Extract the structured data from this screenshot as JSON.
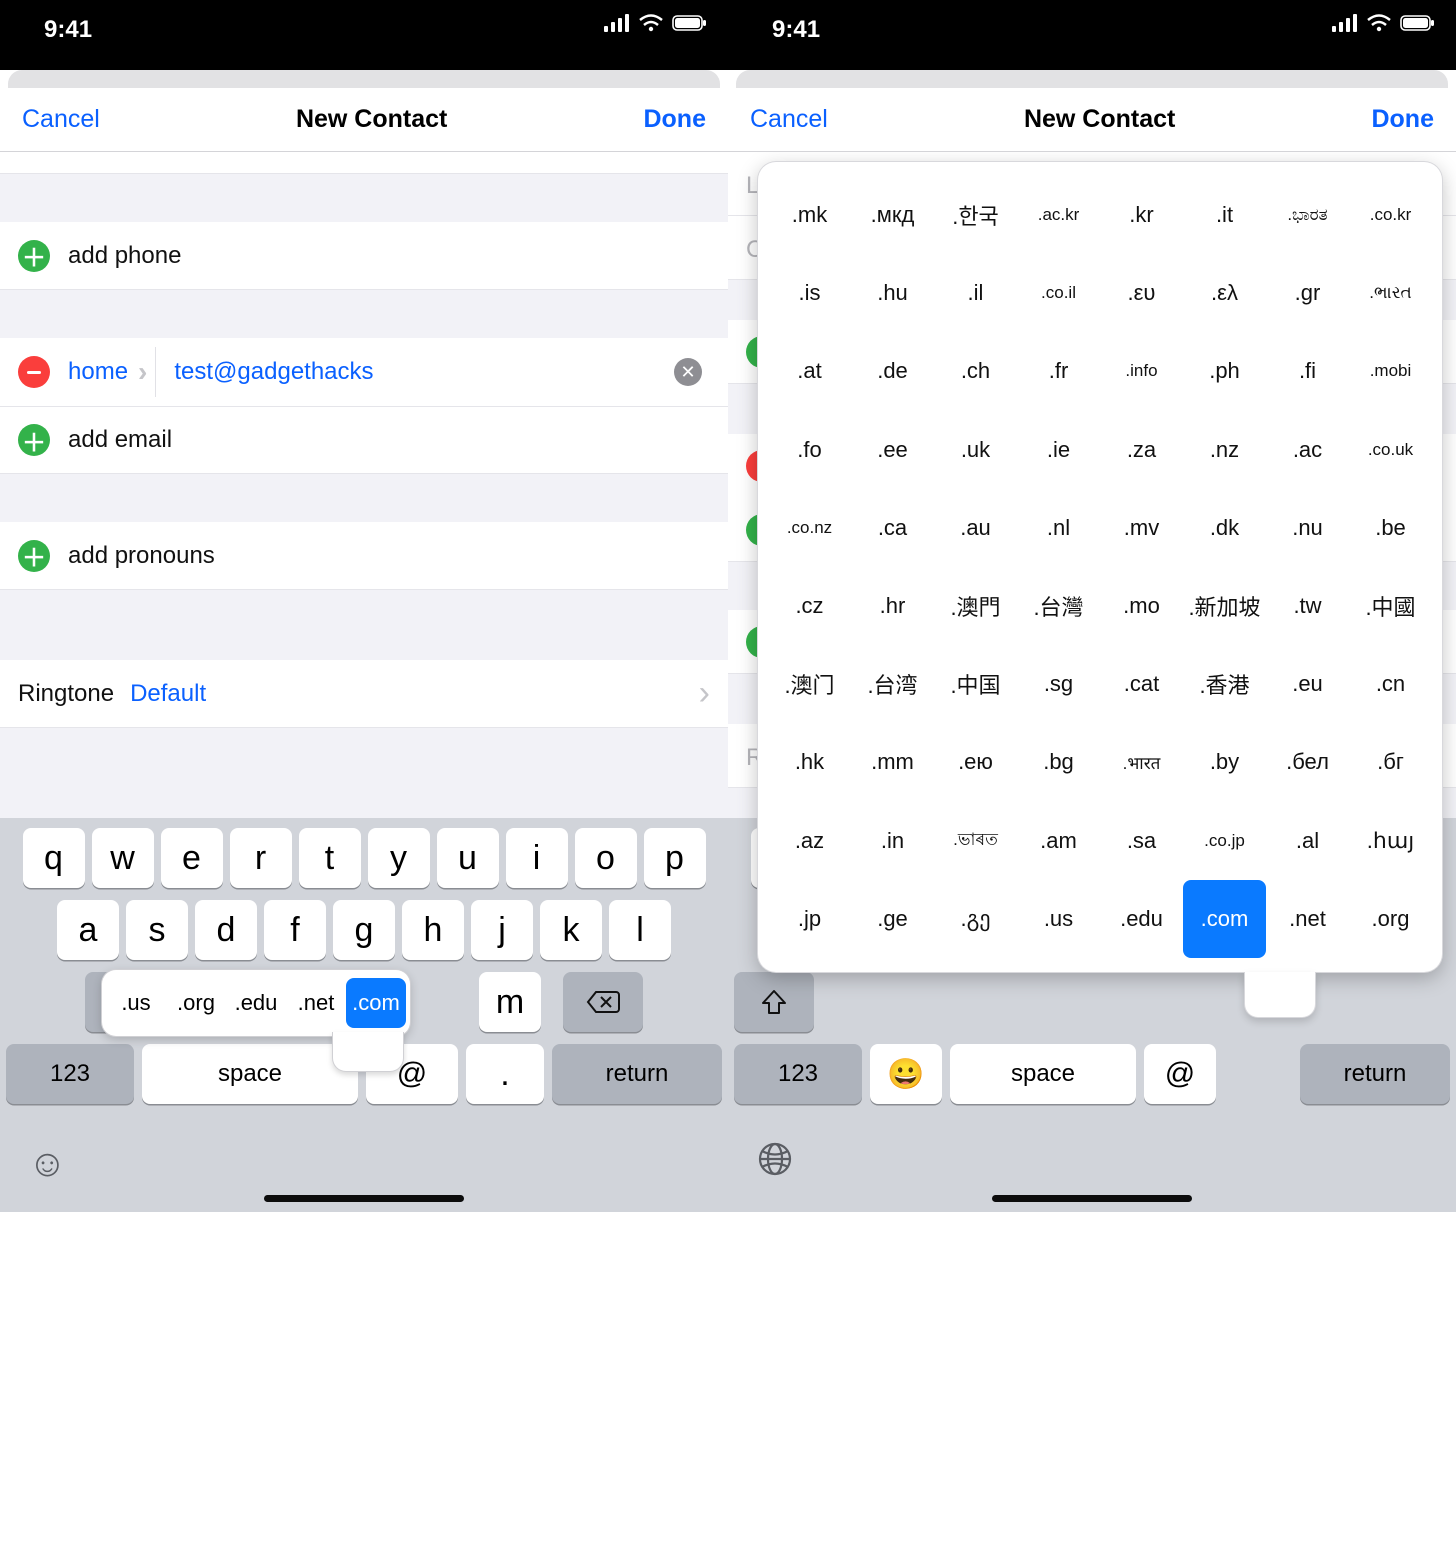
{
  "status": {
    "time": "9:41"
  },
  "nav": {
    "cancel": "Cancel",
    "title": "New Contact",
    "done": "Done"
  },
  "left": {
    "add_phone": "add phone",
    "field_label": "home",
    "email_value": "test@gadgethacks",
    "add_email": "add email",
    "add_pronouns": "add pronouns",
    "ringtone_key": "Ringtone",
    "ringtone_val": "Default"
  },
  "tld_small": [
    ".us",
    ".org",
    ".edu",
    ".net",
    ".com"
  ],
  "tld_small_active_index": 4,
  "keyboard": {
    "row1": [
      "q",
      "w",
      "e",
      "r",
      "t",
      "y",
      "u",
      "i",
      "o",
      "p"
    ],
    "row2": [
      "a",
      "s",
      "d",
      "f",
      "g",
      "h",
      "j",
      "k",
      "l"
    ],
    "numkey": "123",
    "space": "space",
    "at": "@",
    "retkey": "return",
    "m_key": "m",
    "dot_key": "."
  },
  "right_peeks": {
    "L": "L",
    "C": "C",
    "R": "R"
  },
  "tld_large": [
    [
      ".mk",
      ".мкд",
      ".한국",
      ".ac.kr",
      ".kr",
      ".it",
      ".ಭಾರತ",
      ".co.kr"
    ],
    [
      ".is",
      ".hu",
      ".il",
      ".co.il",
      ".ευ",
      ".ελ",
      ".gr",
      ".ભારત"
    ],
    [
      ".at",
      ".de",
      ".ch",
      ".fr",
      ".info",
      ".ph",
      ".fi",
      ".mobi"
    ],
    [
      ".fo",
      ".ee",
      ".uk",
      ".ie",
      ".za",
      ".nz",
      ".ac",
      ".co.uk"
    ],
    [
      ".co.nz",
      ".ca",
      ".au",
      ".nl",
      ".mv",
      ".dk",
      ".nu",
      ".be"
    ],
    [
      ".cz",
      ".hr",
      ".澳門",
      ".台灣",
      ".mo",
      ".新加坡",
      ".tw",
      ".中國"
    ],
    [
      ".澳门",
      ".台湾",
      ".中国",
      ".sg",
      ".cat",
      ".香港",
      ".eu",
      ".cn"
    ],
    [
      ".hk",
      ".mm",
      ".ею",
      ".bg",
      ".भारत",
      ".by",
      ".бел",
      ".бг"
    ],
    [
      ".az",
      ".in",
      ".ভাৰত",
      ".am",
      ".sa",
      ".co.jp",
      ".al",
      ".հայ"
    ],
    [
      ".jp",
      ".ge",
      ".გე",
      ".us",
      ".edu",
      ".com",
      ".net",
      ".org"
    ]
  ],
  "tld_large_active": [
    9,
    5
  ]
}
